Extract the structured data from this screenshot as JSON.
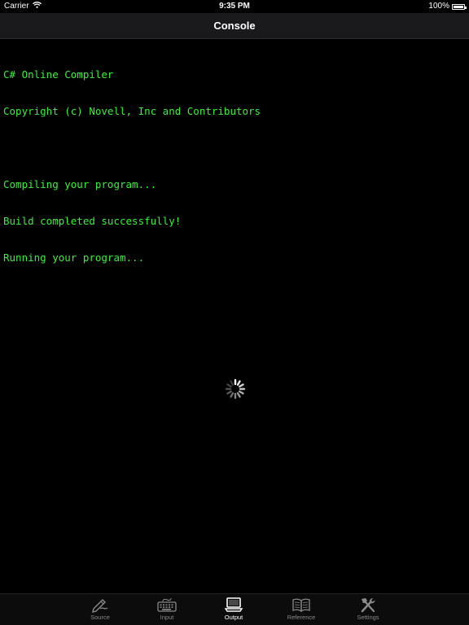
{
  "status": {
    "carrier": "Carrier",
    "time": "9:35 PM",
    "battery": "100%"
  },
  "nav": {
    "title": "Console"
  },
  "console": {
    "lines": [
      "C# Online Compiler",
      "Copyright (c) Novell, Inc and Contributors",
      "",
      "Compiling your program...",
      "Build completed successfully!",
      "Running your program..."
    ]
  },
  "tabs": [
    {
      "label": "Source",
      "icon": "pen-icon"
    },
    {
      "label": "Input",
      "icon": "keyboard-icon"
    },
    {
      "label": "Output",
      "icon": "monitor-icon",
      "active": true
    },
    {
      "label": "Reference",
      "icon": "book-icon"
    },
    {
      "label": "Settings",
      "icon": "tools-icon"
    }
  ],
  "colors": {
    "console_text": "#3af03a",
    "background": "#000000",
    "active_tab": "#ffffff",
    "inactive_tab": "#8a8a8a"
  }
}
